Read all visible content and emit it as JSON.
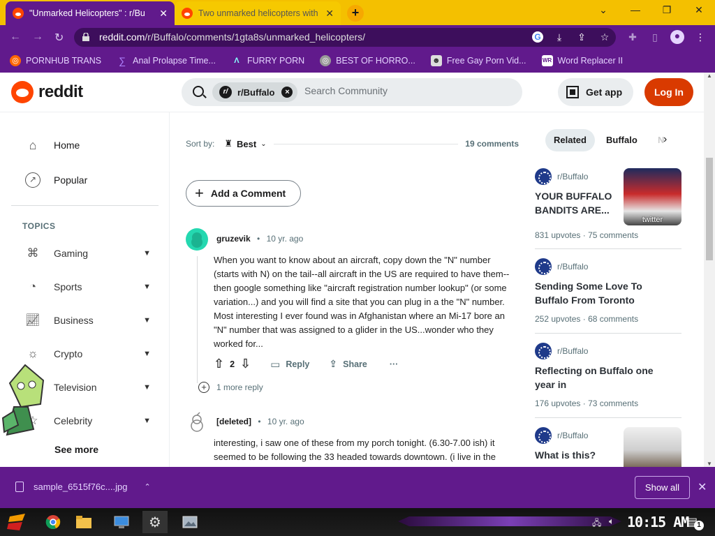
{
  "browser": {
    "tabs": [
      {
        "title": "\"Unmarked Helicopters\" : r/Bu",
        "active": true
      },
      {
        "title": "Two unmarked helicopters with",
        "active": false
      }
    ],
    "new_tab": "+",
    "window_controls": {
      "minimize": "⌄",
      "restore": "—",
      "maximize": "❐",
      "close": "✕"
    },
    "url_host": "reddit.com",
    "url_path": "/r/Buffalo/comments/1gta8s/unmarked_helicopters/",
    "bookmarks": [
      {
        "label": "PORNHUB TRANS",
        "icon": "globe-icon"
      },
      {
        "label": "Anal Prolapse Time...",
        "icon": "bookmark-icon"
      },
      {
        "label": "FURRY PORN",
        "icon": "a-logo-icon"
      },
      {
        "label": "BEST OF HORRO...",
        "icon": "globe-icon"
      },
      {
        "label": "Free Gay Porn Vid...",
        "icon": "character-icon"
      },
      {
        "label": "Word Replacer II",
        "icon": "wr-icon"
      }
    ]
  },
  "header": {
    "logo_text": "reddit",
    "search_chip": "r/Buffalo",
    "search_placeholder": "Search Community",
    "get_app": "Get app",
    "login": "Log In"
  },
  "sidebar": {
    "nav": [
      {
        "label": "Home",
        "icon": "home-icon"
      },
      {
        "label": "Popular",
        "icon": "popular-icon"
      }
    ],
    "topics_heading": "TOPICS",
    "topics": [
      {
        "label": "Gaming",
        "icon": "gamepad-icon"
      },
      {
        "label": "Sports",
        "icon": "ball-icon"
      },
      {
        "label": "Business",
        "icon": "chart-icon"
      },
      {
        "label": "Crypto",
        "icon": "crypto-icon"
      },
      {
        "label": "Television",
        "icon": "tv-icon"
      },
      {
        "label": "Celebrity",
        "icon": "star-icon"
      }
    ],
    "see_more": "See more"
  },
  "main": {
    "sort_label": "Sort by:",
    "sort_value": "Best",
    "comment_count": "19 comments",
    "add_comment": "Add a Comment",
    "comments": [
      {
        "user": "gruzevik",
        "age": "10 yr. ago",
        "body": "When you want to know about an aircraft, copy down the \"N\" number (starts with N) on the tail--all aircraft in the US are required to have them--then google something like \"aircraft registration number lookup\" (or some variation...) and you will find a site that you can plug in a the \"N\" number. Most interesting I ever found was in Afghanistan where an Mi-17 bore an \"N\" number that was assigned to a glider in the US...wonder who they worked for...",
        "score": "2",
        "reply": "Reply",
        "share": "Share",
        "more": "···",
        "more_replies": "1 more reply"
      },
      {
        "user": "[deleted]",
        "age": "10 yr. ago",
        "body": "interesting, i saw one of these from my porch tonight. (6.30-7.00 ish) it seemed to be following the 33 headed towards downtown. (i live in the"
      }
    ]
  },
  "right": {
    "pills": [
      "Related",
      "Buffalo",
      "N"
    ],
    "posts": [
      {
        "sub": "r/Buffalo",
        "title": "YOUR BUFFALO BANDITS ARE...",
        "upvotes": "831 upvotes",
        "comments": "75 comments",
        "thumb_text": "twitter"
      },
      {
        "sub": "r/Buffalo",
        "title": "Sending Some Love To Buffalo From Toronto",
        "upvotes": "252 upvotes",
        "comments": "68 comments"
      },
      {
        "sub": "r/Buffalo",
        "title": "Reflecting on Buffalo one year in",
        "upvotes": "176 upvotes",
        "comments": "73 comments"
      },
      {
        "sub": "r/Buffalo",
        "title": "What is this?"
      }
    ]
  },
  "downloads": {
    "file": "sample_6515f76c....jpg",
    "show_all": "Show all",
    "close": "✕"
  },
  "taskbar": {
    "clock": "10:15 AM",
    "notification_count": "1"
  }
}
